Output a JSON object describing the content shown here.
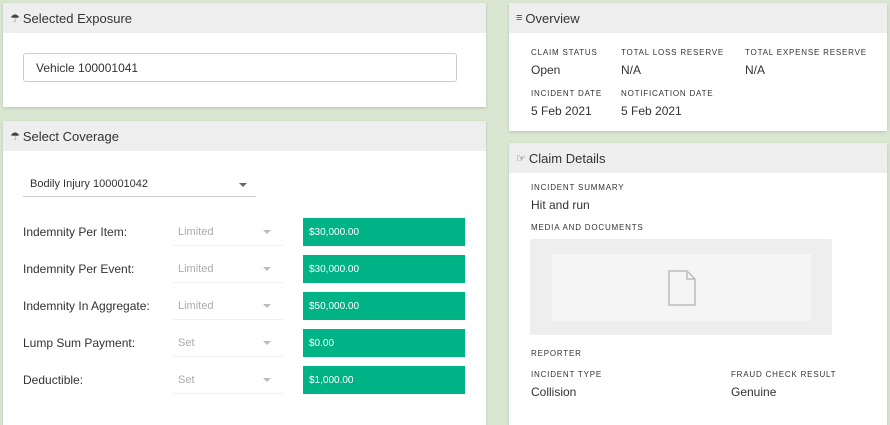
{
  "exposure": {
    "title": "Selected Exposure",
    "icon": "umbrella-icon",
    "selected": "Vehicle 100001041"
  },
  "coverage": {
    "title": "Select Coverage",
    "icon": "umbrella-icon",
    "selected": "Bodily Injury 100001042",
    "rows": [
      {
        "label": "Indemnity Per Item:",
        "type": "Limited",
        "value": "$30,000.00"
      },
      {
        "label": "Indemnity Per Event:",
        "type": "Limited",
        "value": "$30,000.00"
      },
      {
        "label": "Indemnity In Aggregate:",
        "type": "Limited",
        "value": "$50,000.00"
      },
      {
        "label": "Lump Sum Payment:",
        "type": "Set",
        "value": "$0.00"
      },
      {
        "label": "Deductible:",
        "type": "Set",
        "value": "$1,000.00"
      }
    ],
    "value_color": "#00b386"
  },
  "overview": {
    "title": "Overview",
    "icon": "list-icon",
    "claim_status_label": "CLAIM STATUS",
    "claim_status": "Open",
    "total_loss_reserve_label": "TOTAL LOSS RESERVE",
    "total_loss_reserve": "N/A",
    "total_expense_reserve_label": "TOTAL EXPENSE RESERVE",
    "total_expense_reserve": "N/A",
    "incident_date_label": "INCIDENT DATE",
    "incident_date": "5 Feb 2021",
    "notification_date_label": "NOTIFICATION DATE",
    "notification_date": "5 Feb 2021"
  },
  "details": {
    "title": "Claim Details",
    "icon": "pointing-hand-icon",
    "incident_summary_label": "INCIDENT SUMMARY",
    "incident_summary": "Hit and run",
    "media_label": "MEDIA AND DOCUMENTS",
    "reporter_label": "REPORTER",
    "incident_type_label": "INCIDENT TYPE",
    "incident_type": "Collision",
    "fraud_check_label": "FRAUD CHECK RESULT",
    "fraud_check": "Genuine"
  }
}
